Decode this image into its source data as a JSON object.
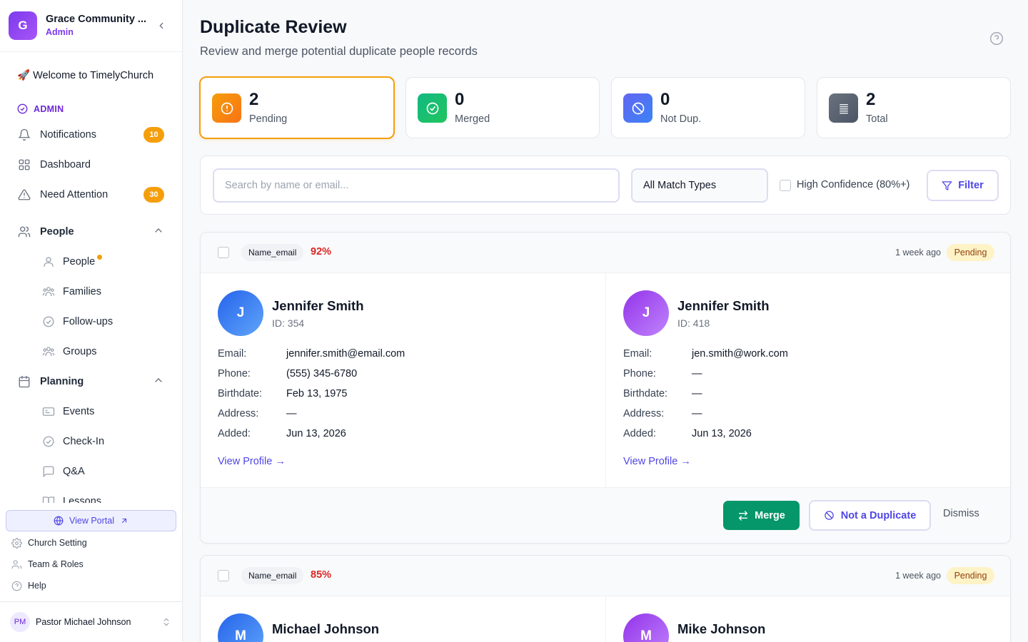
{
  "org": {
    "initial": "G",
    "name": "Grace Community ...",
    "role": "Admin"
  },
  "sidebar": {
    "welcome": "🚀 Welcome to TimelyChurch",
    "section_admin": "ADMIN",
    "items": {
      "notifications": {
        "label": "Notifications",
        "count": "10"
      },
      "dashboard": {
        "label": "Dashboard"
      },
      "need_attention": {
        "label": "Need Attention",
        "count": "30"
      },
      "people_group": {
        "label": "People"
      },
      "people": {
        "label": "People"
      },
      "families": {
        "label": "Families"
      },
      "followups": {
        "label": "Follow-ups"
      },
      "groups": {
        "label": "Groups"
      },
      "planning_group": {
        "label": "Planning"
      },
      "events": {
        "label": "Events"
      },
      "checkin": {
        "label": "Check-In"
      },
      "qa": {
        "label": "Q&A"
      },
      "lessons": {
        "label": "Lessons"
      }
    },
    "portal_button": "View Portal",
    "footer_links": {
      "church_setting": "Church Setting",
      "team_roles": "Team & Roles",
      "help": "Help"
    },
    "user": {
      "initials": "PM",
      "name": "Pastor Michael Johnson"
    }
  },
  "page": {
    "title": "Duplicate Review",
    "subtitle": "Review and merge potential duplicate people records"
  },
  "stats": [
    {
      "value": "2",
      "label": "Pending",
      "color": "#f59e0b"
    },
    {
      "value": "0",
      "label": "Merged",
      "color": "#10b981"
    },
    {
      "value": "0",
      "label": "Not Dup.",
      "color": "#6366f1"
    },
    {
      "value": "2",
      "label": "Total",
      "color": "#6b7280"
    }
  ],
  "filters": {
    "search_placeholder": "Search by name or email...",
    "search_value": "",
    "match_type": "All Match Types",
    "high_confidence_label": "High Confidence (80%+)",
    "high_confidence_checked": false,
    "filter_button": "Filter"
  },
  "labels": {
    "email": "Email:",
    "phone": "Phone:",
    "birthdate": "Birthdate:",
    "address": "Address:",
    "added": "Added:",
    "view_profile": "View Profile →",
    "merge": "Merge",
    "not_duplicate": "Not a Duplicate",
    "dismiss": "Dismiss"
  },
  "duplicates": [
    {
      "match_type": "Name_email",
      "confidence": "92%",
      "time_ago": "1 week ago",
      "status": "Pending",
      "records": [
        {
          "initial": "J",
          "name": "Jennifer Smith",
          "id": "ID: 354",
          "email": "jennifer.smith@email.com",
          "phone": "(555) 345-6780",
          "birthdate": "Feb 13, 1975",
          "address": "—",
          "added": "Jun 13, 2026"
        },
        {
          "initial": "J",
          "name": "Jennifer Smith",
          "id": "ID: 418",
          "email": "jen.smith@work.com",
          "phone": "—",
          "birthdate": "—",
          "address": "—",
          "added": "Jun 13, 2026"
        }
      ]
    },
    {
      "match_type": "Name_email",
      "confidence": "85%",
      "time_ago": "1 week ago",
      "status": "Pending",
      "records": [
        {
          "initial": "M",
          "name": "Michael Johnson"
        },
        {
          "initial": "M",
          "name": "Mike Johnson"
        }
      ]
    }
  ]
}
